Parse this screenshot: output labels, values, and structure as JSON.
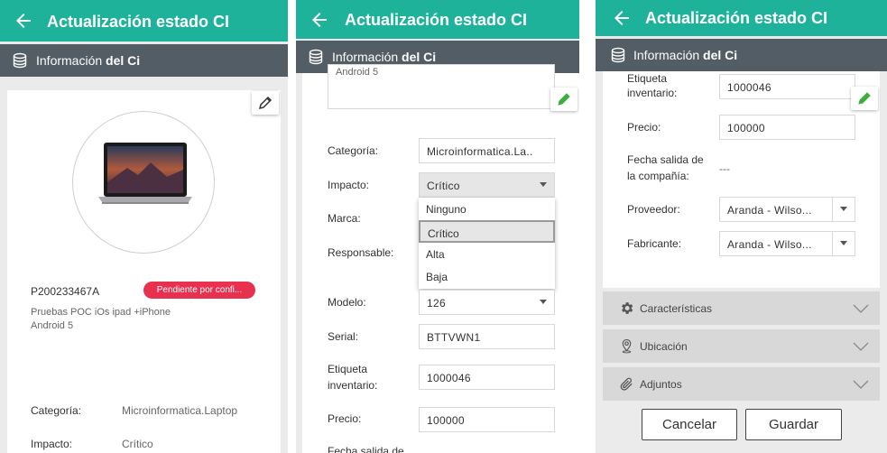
{
  "app": {
    "title": "Actualización estado CI",
    "subheader_prefix": "Información",
    "subheader_bold": "del Ci"
  },
  "panel1": {
    "code": "P200233467A",
    "status_badge": "Pendiente por confi...",
    "description_line1": "Pruebas POC iOs ipad +iPhone",
    "description_line2": "Android 5",
    "rows": [
      {
        "label": "Categoría:",
        "value": "Microinformatica.Laptop"
      },
      {
        "label": "Impacto:",
        "value": "Crítico"
      }
    ]
  },
  "panel2": {
    "textarea_value": "Android 5",
    "labels": {
      "categoria": "Categoría:",
      "impacto": "Impacto:",
      "marca": "Marca:",
      "responsable": "Responsable:",
      "modelo": "Modelo:",
      "serial": "Serial:",
      "etiqueta_1": "Etiqueta",
      "etiqueta_2": "inventario:",
      "precio": "Precio:",
      "fecha": "Fecha salida de"
    },
    "values": {
      "categoria": "Microinformatica.La..",
      "impacto": "Crítico",
      "modelo": "126",
      "serial": "BTTVWN1",
      "etiqueta": "1000046",
      "precio": "100000"
    },
    "impact_options": [
      "Ninguno",
      "Crítico",
      "Alta",
      "Baja"
    ]
  },
  "panel3": {
    "labels": {
      "etiqueta_1": "Etiqueta",
      "etiqueta_2": "inventario:",
      "precio": "Precio:",
      "fecha_1": "Fecha salida de",
      "fecha_2": "la compañía:",
      "proveedor": "Proveedor:",
      "fabricante": "Fabricante:"
    },
    "values": {
      "etiqueta": "1000046",
      "precio": "100000",
      "fecha": "---",
      "proveedor": "Aranda - Wilso...",
      "fabricante": "Aranda - Wilso..."
    },
    "sections": {
      "caracteristicas": "Características",
      "ubicacion": "Ubicación",
      "adjuntos": "Adjuntos"
    },
    "buttons": {
      "cancel": "Cancelar",
      "save": "Guardar"
    }
  },
  "colors": {
    "primary": "#1eb29b",
    "subheader": "#535d66",
    "badge": "#e8304f",
    "edit_green": "#3cae3c"
  }
}
